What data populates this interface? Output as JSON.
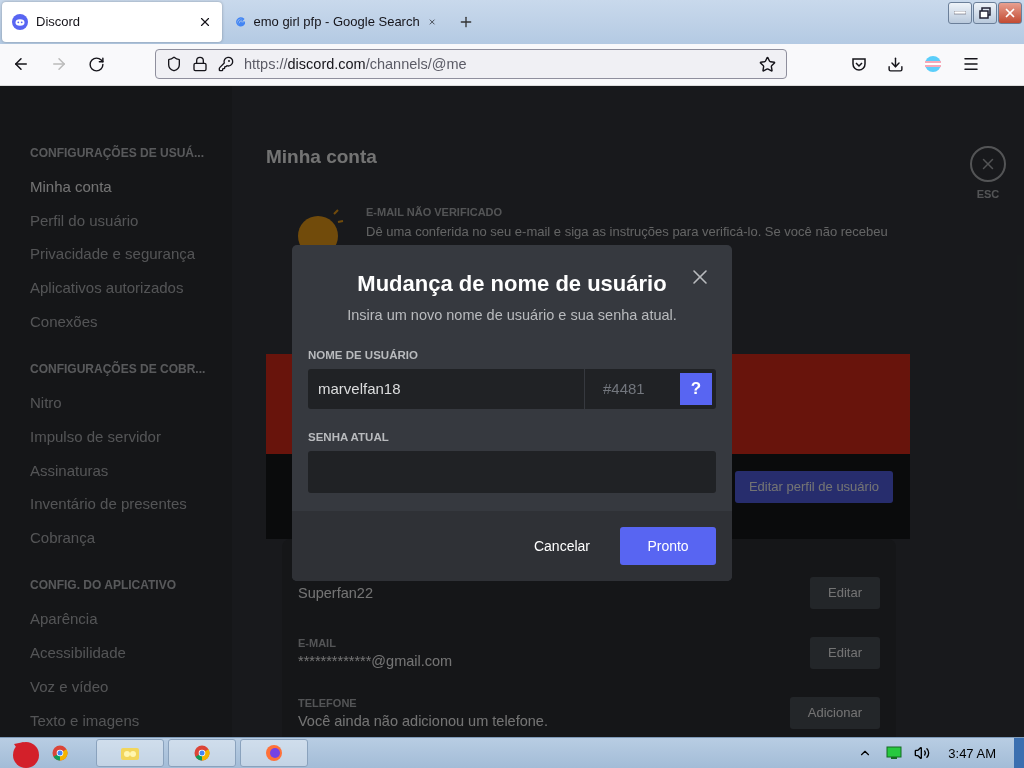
{
  "browser": {
    "tabs": [
      {
        "title": "Discord",
        "selected": true,
        "kind": "discord"
      },
      {
        "title": "emo girl pfp - Google Search",
        "selected": false,
        "kind": "google"
      }
    ],
    "url": {
      "scheme": "https://",
      "host": "discord.com",
      "path": "/channels/@me"
    }
  },
  "sidebar": {
    "sections": [
      {
        "heading": "CONFIGURAÇÕES DE USUÁ...",
        "items": [
          {
            "label": "Minha conta",
            "selected": true
          },
          {
            "label": "Perfil do usuário",
            "selected": false
          },
          {
            "label": "Privacidade e segurança",
            "selected": false
          },
          {
            "label": "Aplicativos autorizados",
            "selected": false
          },
          {
            "label": "Conexões",
            "selected": false
          }
        ]
      },
      {
        "heading": "CONFIGURAÇÕES DE COBR...",
        "items": [
          {
            "label": "Nitro",
            "selected": false
          },
          {
            "label": "Impulso de servidor",
            "selected": false
          },
          {
            "label": "Assinaturas",
            "selected": false
          },
          {
            "label": "Inventário de presentes",
            "selected": false
          },
          {
            "label": "Cobrança",
            "selected": false
          }
        ]
      },
      {
        "heading": "CONFIG. DO APLICATIVO",
        "items": [
          {
            "label": "Aparência",
            "selected": false
          },
          {
            "label": "Acessibilidade",
            "selected": false
          },
          {
            "label": "Voz e vídeo",
            "selected": false
          },
          {
            "label": "Texto e imagens",
            "selected": false
          }
        ]
      }
    ]
  },
  "main": {
    "title": "Minha conta",
    "close_hint": "ESC",
    "email_notice": {
      "heading": "E-MAIL NÃO VERIFICADO",
      "text": "Dê uma conferida no seu e-mail e siga as instruções para verificá-lo. Se você não recebeu"
    },
    "edit_profile_button": "Editar perfil de usuário",
    "fields": [
      {
        "value": "Superfan22",
        "button": "Editar"
      },
      {
        "label": "E-MAIL",
        "value": "*************@gmail.com",
        "button": "Editar"
      },
      {
        "label": "TELEFONE",
        "value": "Você ainda não adicionou um telefone.",
        "button": "Adicionar"
      }
    ]
  },
  "modal": {
    "title": "Mudança de nome de usuário",
    "subtitle": "Insira um novo nome de usuário e sua senha atual.",
    "username_label": "NOME DE USUÁRIO",
    "username": "marvelfan18",
    "discriminator": "#4481",
    "help": "?",
    "password_label": "SENHA ATUAL",
    "cancel": "Cancelar",
    "confirm": "Pronto"
  },
  "taskbar": {
    "time": "3:47 AM"
  }
}
